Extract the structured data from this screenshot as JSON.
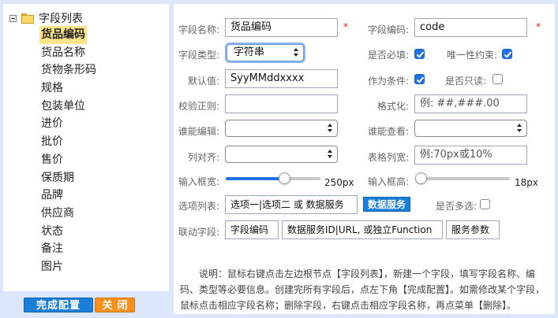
{
  "tree": {
    "root_label": "字段列表",
    "items": [
      {
        "label": "货品编码",
        "selected": true
      },
      {
        "label": "货品名称"
      },
      {
        "label": "货物条形码"
      },
      {
        "label": "规格"
      },
      {
        "label": "包装单位"
      },
      {
        "label": "进价"
      },
      {
        "label": "批价"
      },
      {
        "label": "售价"
      },
      {
        "label": "保质期"
      },
      {
        "label": "品牌"
      },
      {
        "label": "供应商"
      },
      {
        "label": "状态"
      },
      {
        "label": "备注"
      },
      {
        "label": "图片"
      }
    ]
  },
  "buttons": {
    "done": "完成配置",
    "close": "关闭"
  },
  "form": {
    "field_name": {
      "label": "字段名称:",
      "value": "货品编码"
    },
    "field_code": {
      "label": "字段编码:",
      "value": "code"
    },
    "field_type": {
      "label": "字段类型:",
      "value": "字符串"
    },
    "required": {
      "label": "是否必填:",
      "checked": true
    },
    "unique": {
      "label": "唯一性约束:",
      "checked": true
    },
    "default_value": {
      "label": "默认值:",
      "value": "SyyMMddxxxx"
    },
    "as_condition": {
      "label": "作为条件:",
      "checked": true
    },
    "readonly": {
      "label": "是否只读:",
      "checked": false
    },
    "validation": {
      "label": "校验正则:",
      "value": ""
    },
    "format": {
      "label": "格式化:",
      "placeholder": "例: ##,###.00"
    },
    "who_edit": {
      "label": "谁能编辑:",
      "value": ""
    },
    "who_view": {
      "label": "谁能查看:",
      "value": ""
    },
    "align": {
      "label": "列对齐:",
      "value": ""
    },
    "col_width": {
      "label": "表格列宽:",
      "placeholder": "例:70px或10%"
    },
    "input_width": {
      "label": "输入框宽:",
      "value": "250px",
      "fraction": 0.62
    },
    "input_height": {
      "label": "输入框高:",
      "value": "18px",
      "fraction": 0.0
    },
    "options": {
      "label": "选项列表:",
      "placeholder": "选项一|选项二 或 数据服务"
    },
    "data_service_button": "数据服务",
    "multi_select": {
      "label": "是否多选:",
      "checked": false
    },
    "linked": {
      "label": "联动字段:",
      "placeholders": [
        "字段编码",
        "数据服务ID|URL, 或独立Function",
        "服务参数"
      ]
    }
  },
  "note": "说明：鼠标右键点击左边根节点【字段列表】，新建一个字段，填写字段名称、编码、类型等必要信息。创建完所有字段后，点左下角【完成配置】。如需修改某个字段，鼠标点击相应字段名称；删除字段，右键点击相应字段名称，再点菜单【删除】。",
  "colors": {
    "background": "#dde7fb",
    "accent_blue": "#1a7fd9",
    "accent_orange": "#f5901e",
    "selected_item": "#ffe58a",
    "required_star": "#e02020"
  }
}
